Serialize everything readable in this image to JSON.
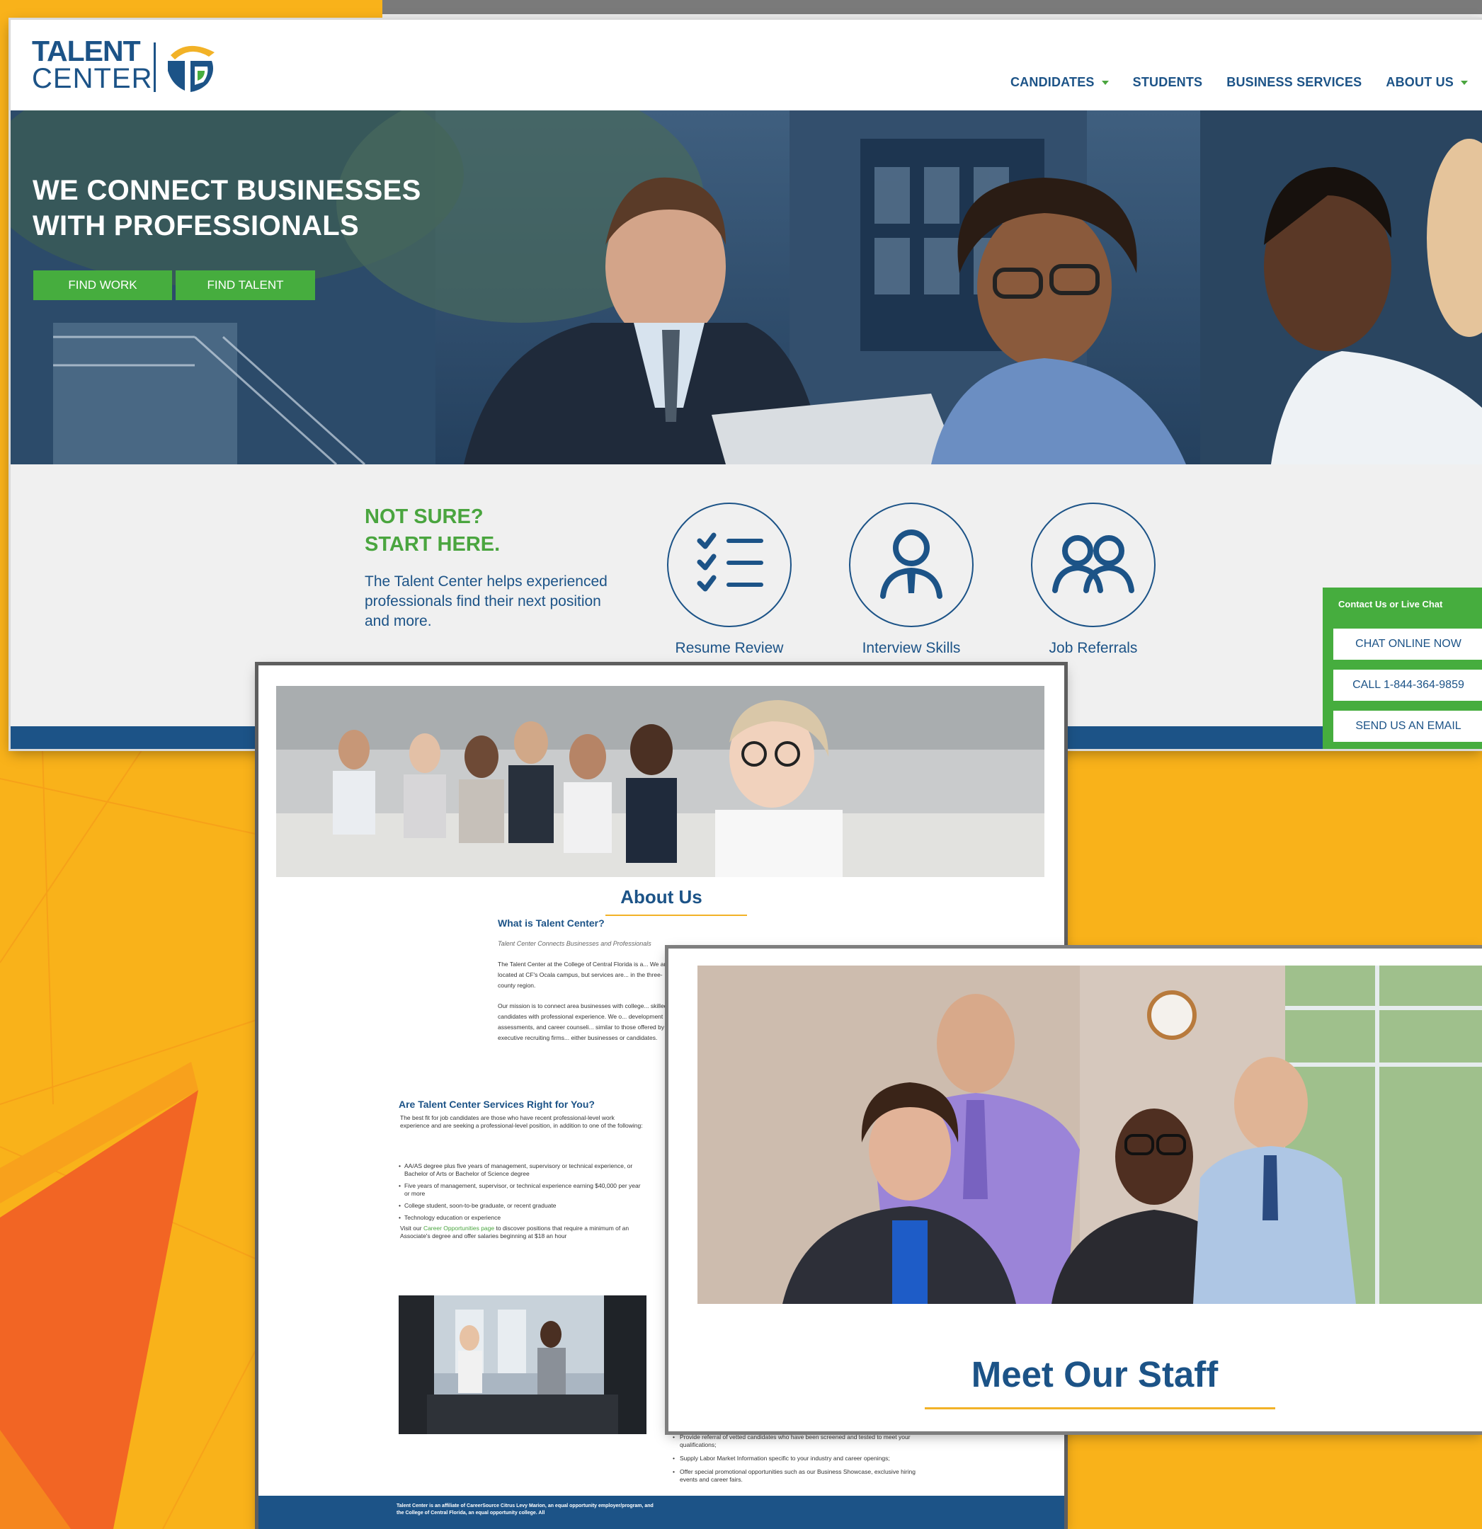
{
  "brand": {
    "logo_line1": "TALENT",
    "logo_line2": "CENTER",
    "colors": {
      "navy": "#1c5387",
      "green": "#46ad3e",
      "gold": "#f2b227",
      "orange_bg": "#f9b21a"
    }
  },
  "nav": {
    "items": [
      {
        "label": "CANDIDATES",
        "has_dropdown": true
      },
      {
        "label": "STUDENTS",
        "has_dropdown": false
      },
      {
        "label": "BUSINESS SERVICES",
        "has_dropdown": false
      },
      {
        "label": "ABOUT US",
        "has_dropdown": true
      }
    ]
  },
  "hero": {
    "title_line1": "WE CONNECT BUSINESSES",
    "title_line2": "WITH PROFESSIONALS",
    "btn_find_work": "FIND WORK",
    "btn_find_talent": "FIND TALENT"
  },
  "intro": {
    "heading_line1": "NOT SURE?",
    "heading_line2": "START HERE.",
    "body": "The Talent Center helps experienced professionals find their next position and more.",
    "services": [
      {
        "label": "Resume Review",
        "icon": "checklist-icon"
      },
      {
        "label": "Interview Skills",
        "icon": "person-icon"
      },
      {
        "label": "Job Referrals",
        "icon": "people-icon"
      }
    ]
  },
  "contact_widget": {
    "title": "Contact Us or Live Chat",
    "chat": "CHAT ONLINE NOW",
    "call": "CALL 1-844-364-9859",
    "email": "SEND US AN EMAIL"
  },
  "about_page": {
    "heading": "About Us",
    "what_title": "What is Talent Center?",
    "what_subtitle": "Talent Center Connects Businesses and Professionals",
    "para1": "The Talent Center at the College of Central Florida is a... We are located at CF's Ocala campus, but services are... in the three-county region.",
    "para2": "Our mission is to connect area businesses with college... skilled candidates with professional experience. We o... development and assessments, and career counseli... similar to those offered by executive recruiting firms... either businesses or candidates.",
    "right_title": "Are Talent Center Services Right for You?",
    "right_intro": "The best fit for job candidates are those who have recent professional-level work experience and are seeking a professional-level position, in addition to one of the following:",
    "right_bullets": [
      "AA/AS degree plus five years of management, supervisory or technical experience, or Bachelor of Arts or Bachelor of Science degree",
      "Five years of management, supervisor, or technical experience earning $40,000 per year or more",
      "College student, soon-to-be graduate, or recent graduate",
      "Technology education or experience"
    ],
    "visit_prefix": "Visit our",
    "visit_link": "Career Opportunities page",
    "visit_suffix": "to discover positions that require a minimum of an Associate's degree and offer salaries beginning at $18 an hour",
    "lower_bullets": [
      "Provide referral of vetted candidates who have been screened and tested to meet your qualifications;",
      "Supply Labor Market Information specific to your industry and career openings;",
      "Offer special promotional opportunities such as our Business Showcase, exclusive hiring events and career fairs."
    ],
    "footer_text": "Talent Center is an affiliate of CareerSource Citrus Levy Marion, an equal opportunity employer/program, and the College of Central Florida, an equal opportunity college. All"
  },
  "staff_page": {
    "heading": "Meet Our Staff"
  }
}
